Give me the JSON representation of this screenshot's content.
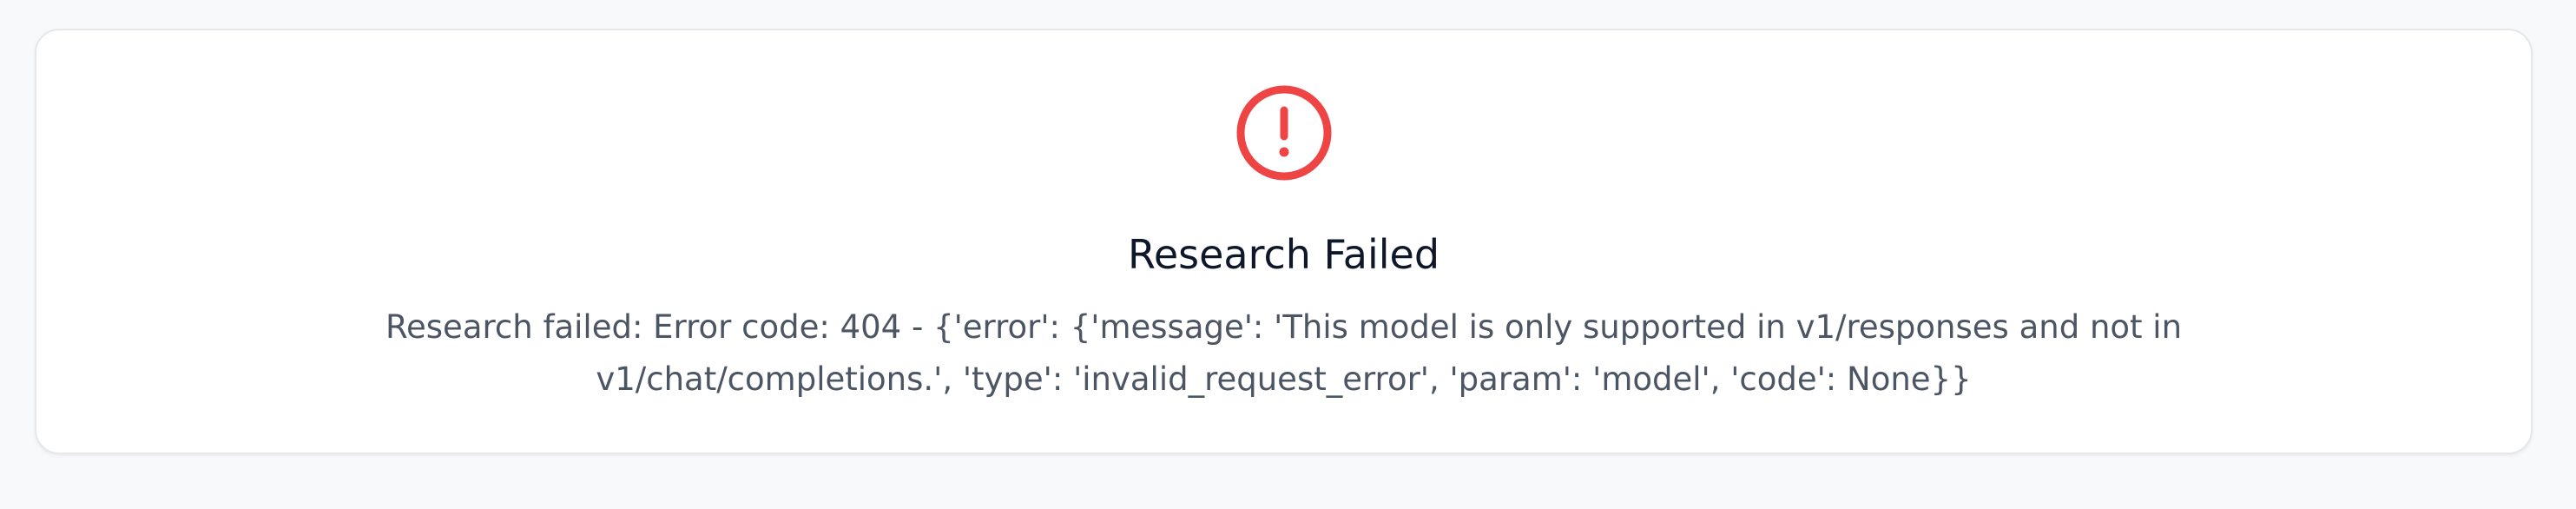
{
  "error_card": {
    "icon": "alert-circle-icon",
    "accent_color": "#ef4444",
    "title": "Research Failed",
    "message": "Research failed: Error code: 404 - {'error': {'message': 'This model is only supported in v1/responses and not in v1/chat/completions.', 'type': 'invalid_request_error', 'param': 'model', 'code': None}}"
  }
}
